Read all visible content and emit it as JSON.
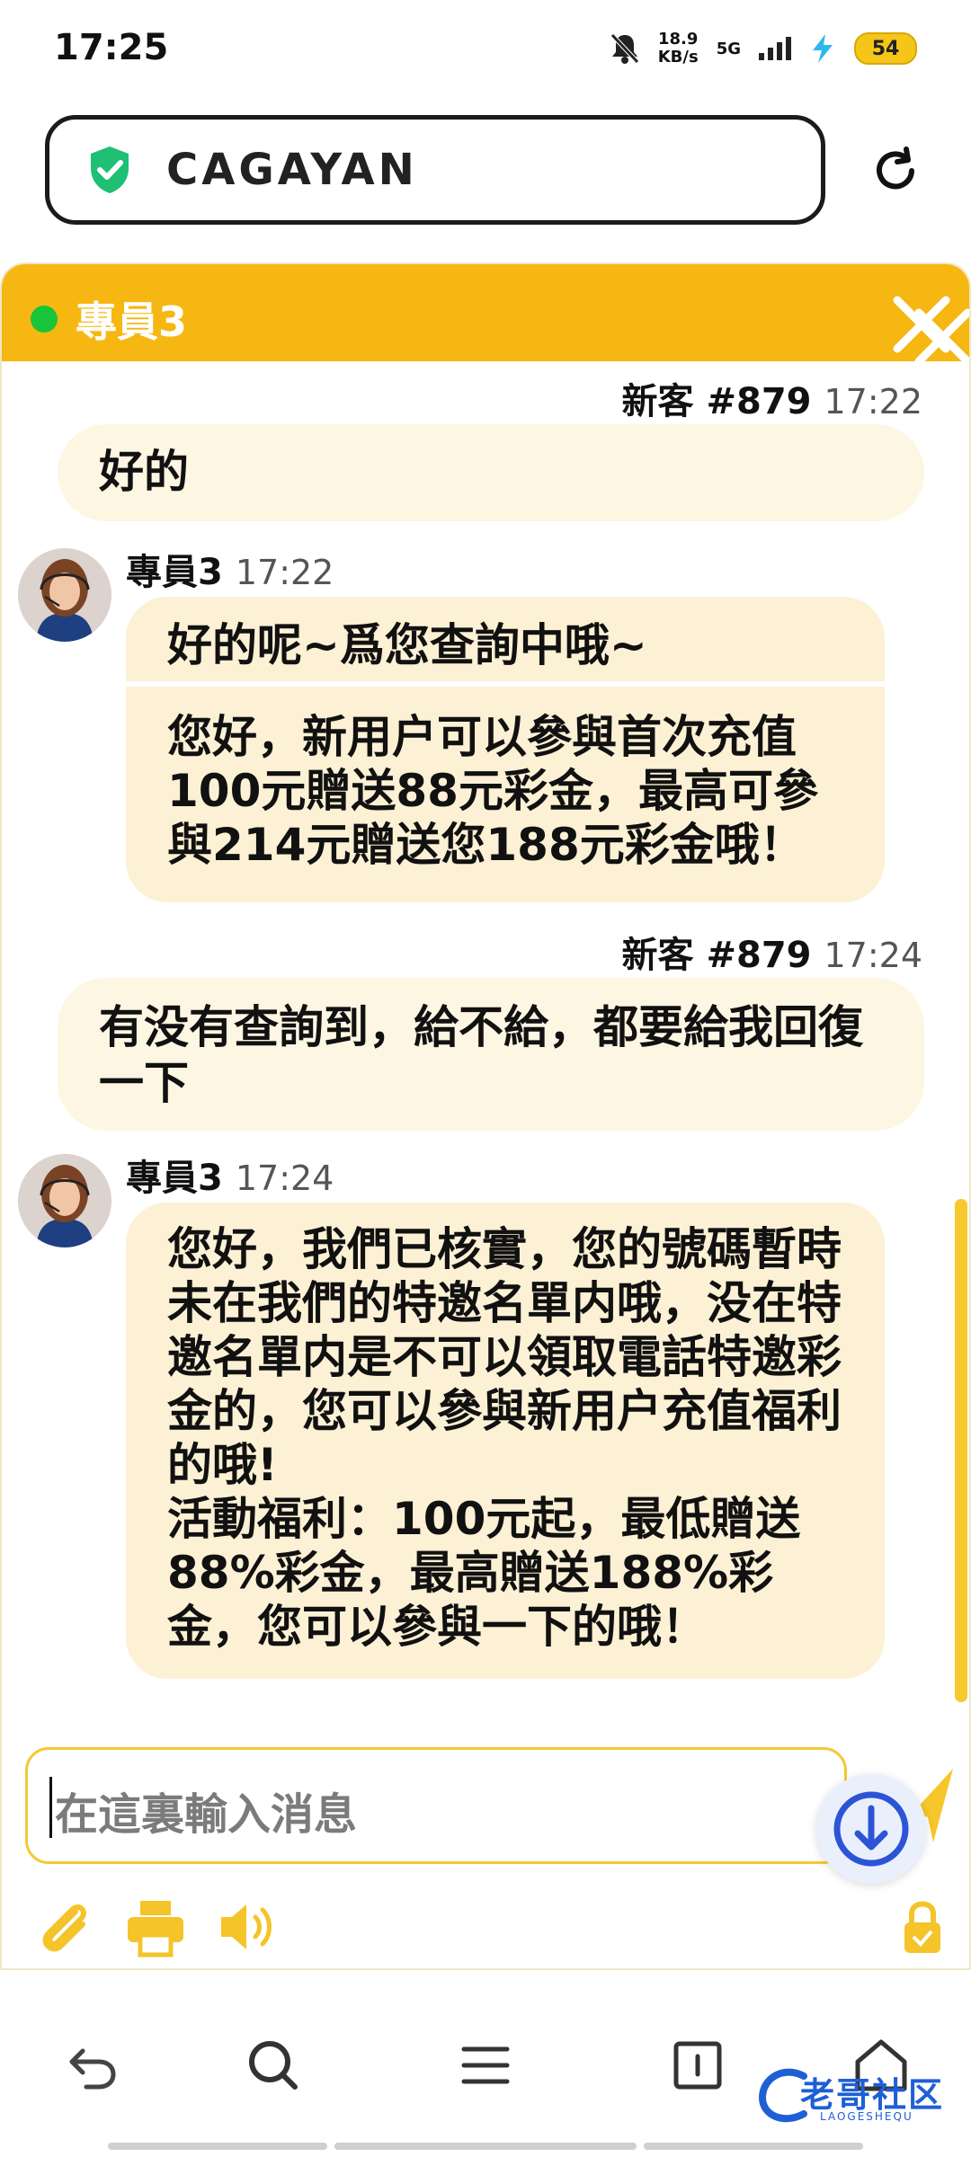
{
  "status_bar": {
    "time": "17:25",
    "net_speed": "18.9",
    "net_unit": "KB/s",
    "signal": "5G",
    "battery": "54"
  },
  "browser": {
    "url": "CAGAYAN"
  },
  "chat": {
    "header_title": "專員3",
    "messages": [
      {
        "sender": "新客 #879",
        "time": "17:22",
        "segments": [
          "好的"
        ]
      },
      {
        "sender": "專員3",
        "time": "17:22",
        "segments": [
          "好的呢~爲您查詢中哦~",
          "您好，新用户可以參與首次充值100元贈送88元彩金，最高可參與214元贈送您188元彩金哦！"
        ]
      },
      {
        "sender": "新客 #879",
        "time": "17:24",
        "segments": [
          "有没有查詢到，給不給，都要給我回復一下"
        ]
      },
      {
        "sender": "專員3",
        "time": "17:24",
        "segments": [
          "您好，我們已核實，您的號碼暫時未在我們的特邀名單内哦，没在特邀名單内是不可以領取電話特邀彩金的，您可以參與新用户充值福利的哦!\n活動福利：100元起，最低贈送88%彩金，最高贈送188%彩金，您可以參與一下的哦！"
        ]
      }
    ],
    "input_placeholder": "在這裏輸入消息"
  },
  "watermark": {
    "text": "老哥社区",
    "sub": "LAOGESHEQU"
  },
  "colors": {
    "accent": "#f6b712",
    "online": "#19c43a",
    "bubble_me": "#fdf6e2",
    "bubble_agent": "#fcf1d4",
    "shield": "#1fbf74"
  },
  "icons": [
    "shield-check-icon",
    "reload-icon",
    "close-icon",
    "paperclip-icon",
    "printer-icon",
    "speaker-icon",
    "lock-icon",
    "send-icon",
    "download-icon",
    "back-icon",
    "search-icon",
    "menu-icon",
    "tabs-icon",
    "home-icon"
  ]
}
